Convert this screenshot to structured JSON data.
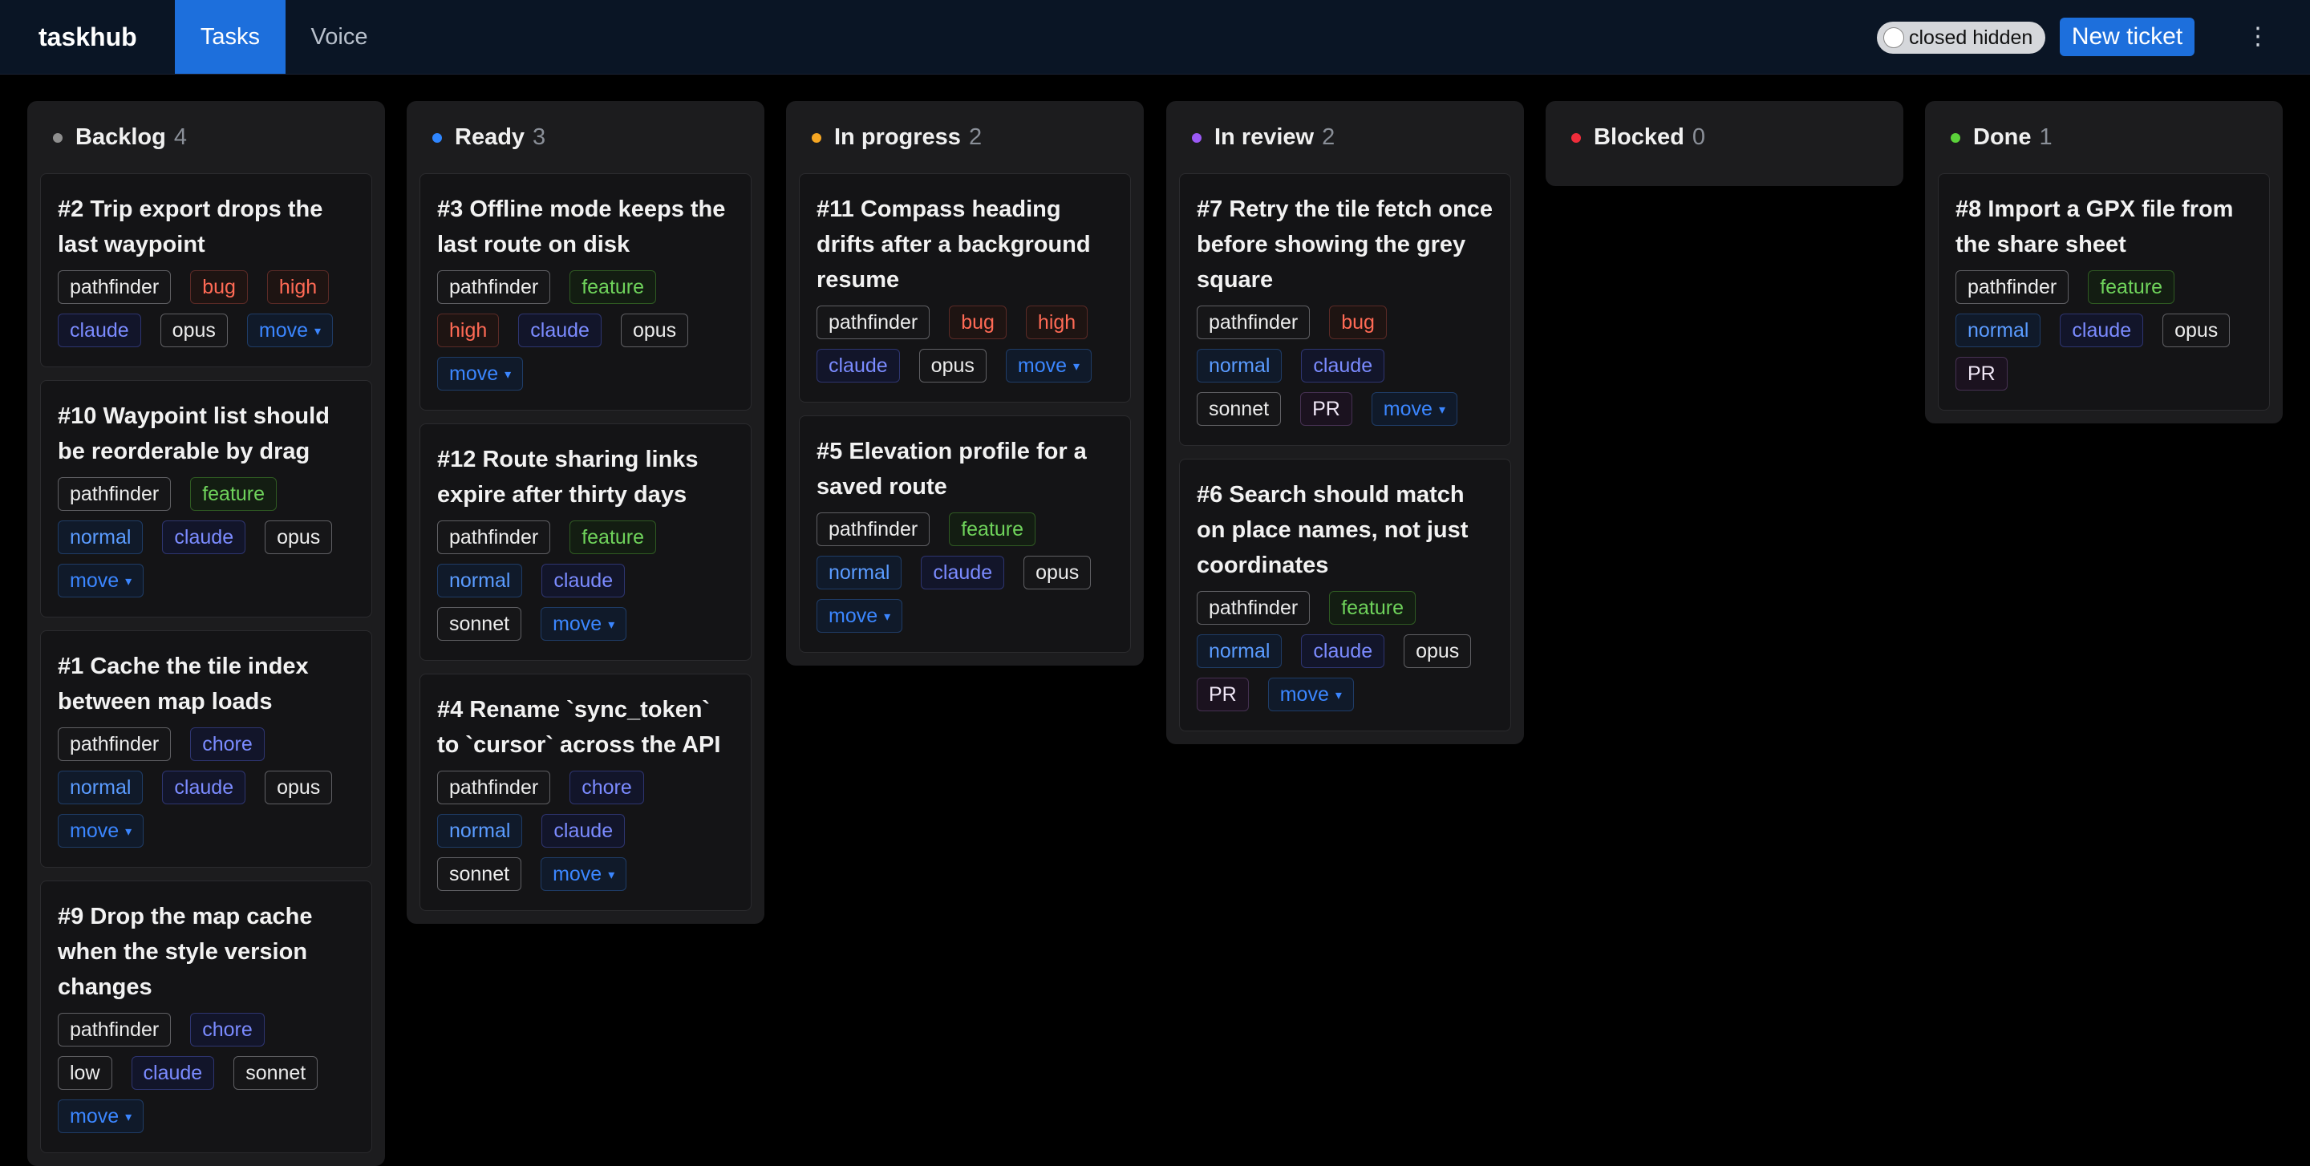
{
  "header": {
    "brand": "taskhub",
    "tabs": [
      "Tasks",
      "Voice"
    ],
    "active_tab": "Tasks",
    "toggle_label": "closed hidden",
    "new_ticket_label": "New ticket",
    "menu_glyph": "⋮"
  },
  "colors": {
    "accent": "#1d6fdc",
    "backlog": "#8f8f8f",
    "ready": "#2f86ff",
    "in_progress": "#f5a623",
    "in_review": "#9b59f5",
    "blocked": "#ef2d3b",
    "done": "#5bd23a"
  },
  "move_label": "move",
  "move_caret": "▾",
  "columns": [
    {
      "title": "Backlog",
      "count": "4",
      "cards": [
        {
          "title": "#2 Trip export drops the last waypoint",
          "tags": [
            "pathfinder",
            "bug",
            "high",
            "claude",
            "opus"
          ]
        },
        {
          "title": "#10 Waypoint list should be reorderable by drag",
          "tags": [
            "pathfinder",
            "feature",
            "normal",
            "claude",
            "opus"
          ]
        },
        {
          "title": "#1 Cache the tile index between map loads",
          "tags": [
            "pathfinder",
            "chore",
            "normal",
            "claude",
            "opus"
          ]
        },
        {
          "title": "#9 Drop the map cache when the style version changes",
          "tags": [
            "pathfinder",
            "chore",
            "low",
            "claude",
            "sonnet"
          ]
        }
      ]
    },
    {
      "title": "Ready",
      "count": "3",
      "cards": [
        {
          "title": "#3 Offline mode keeps the last route on disk",
          "tags": [
            "pathfinder",
            "feature",
            "high",
            "claude",
            "opus"
          ]
        },
        {
          "title": "#12 Route sharing links expire after thirty days",
          "tags": [
            "pathfinder",
            "feature",
            "normal",
            "claude",
            "sonnet"
          ]
        },
        {
          "title": "#4 Rename `sync_token` to `cursor` across the API",
          "tags": [
            "pathfinder",
            "chore",
            "normal",
            "claude",
            "sonnet"
          ]
        }
      ]
    },
    {
      "title": "In progress",
      "count": "2",
      "cards": [
        {
          "title": "#11 Compass heading drifts after a background resume",
          "tags": [
            "pathfinder",
            "bug",
            "high",
            "claude",
            "opus"
          ]
        },
        {
          "title": "#5 Elevation profile for a saved route",
          "tags": [
            "pathfinder",
            "feature",
            "normal",
            "claude",
            "opus"
          ]
        }
      ]
    },
    {
      "title": "In review",
      "count": "2",
      "cards": [
        {
          "title": "#7 Retry the tile fetch once before showing the grey square",
          "tags": [
            "pathfinder",
            "bug",
            "normal",
            "claude",
            "sonnet",
            "PR"
          ]
        },
        {
          "title": "#6 Search should match on place names, not just coordinates",
          "tags": [
            "pathfinder",
            "feature",
            "normal",
            "claude",
            "opus",
            "PR"
          ]
        }
      ]
    },
    {
      "title": "Blocked",
      "count": "0",
      "cards": []
    },
    {
      "title": "Done",
      "count": "1",
      "cards": [
        {
          "title": "#8 Import a GPX file from the share sheet",
          "tags": [
            "pathfinder",
            "feature",
            "normal",
            "claude",
            "opus",
            "PR"
          ],
          "no_move": true
        }
      ]
    }
  ]
}
